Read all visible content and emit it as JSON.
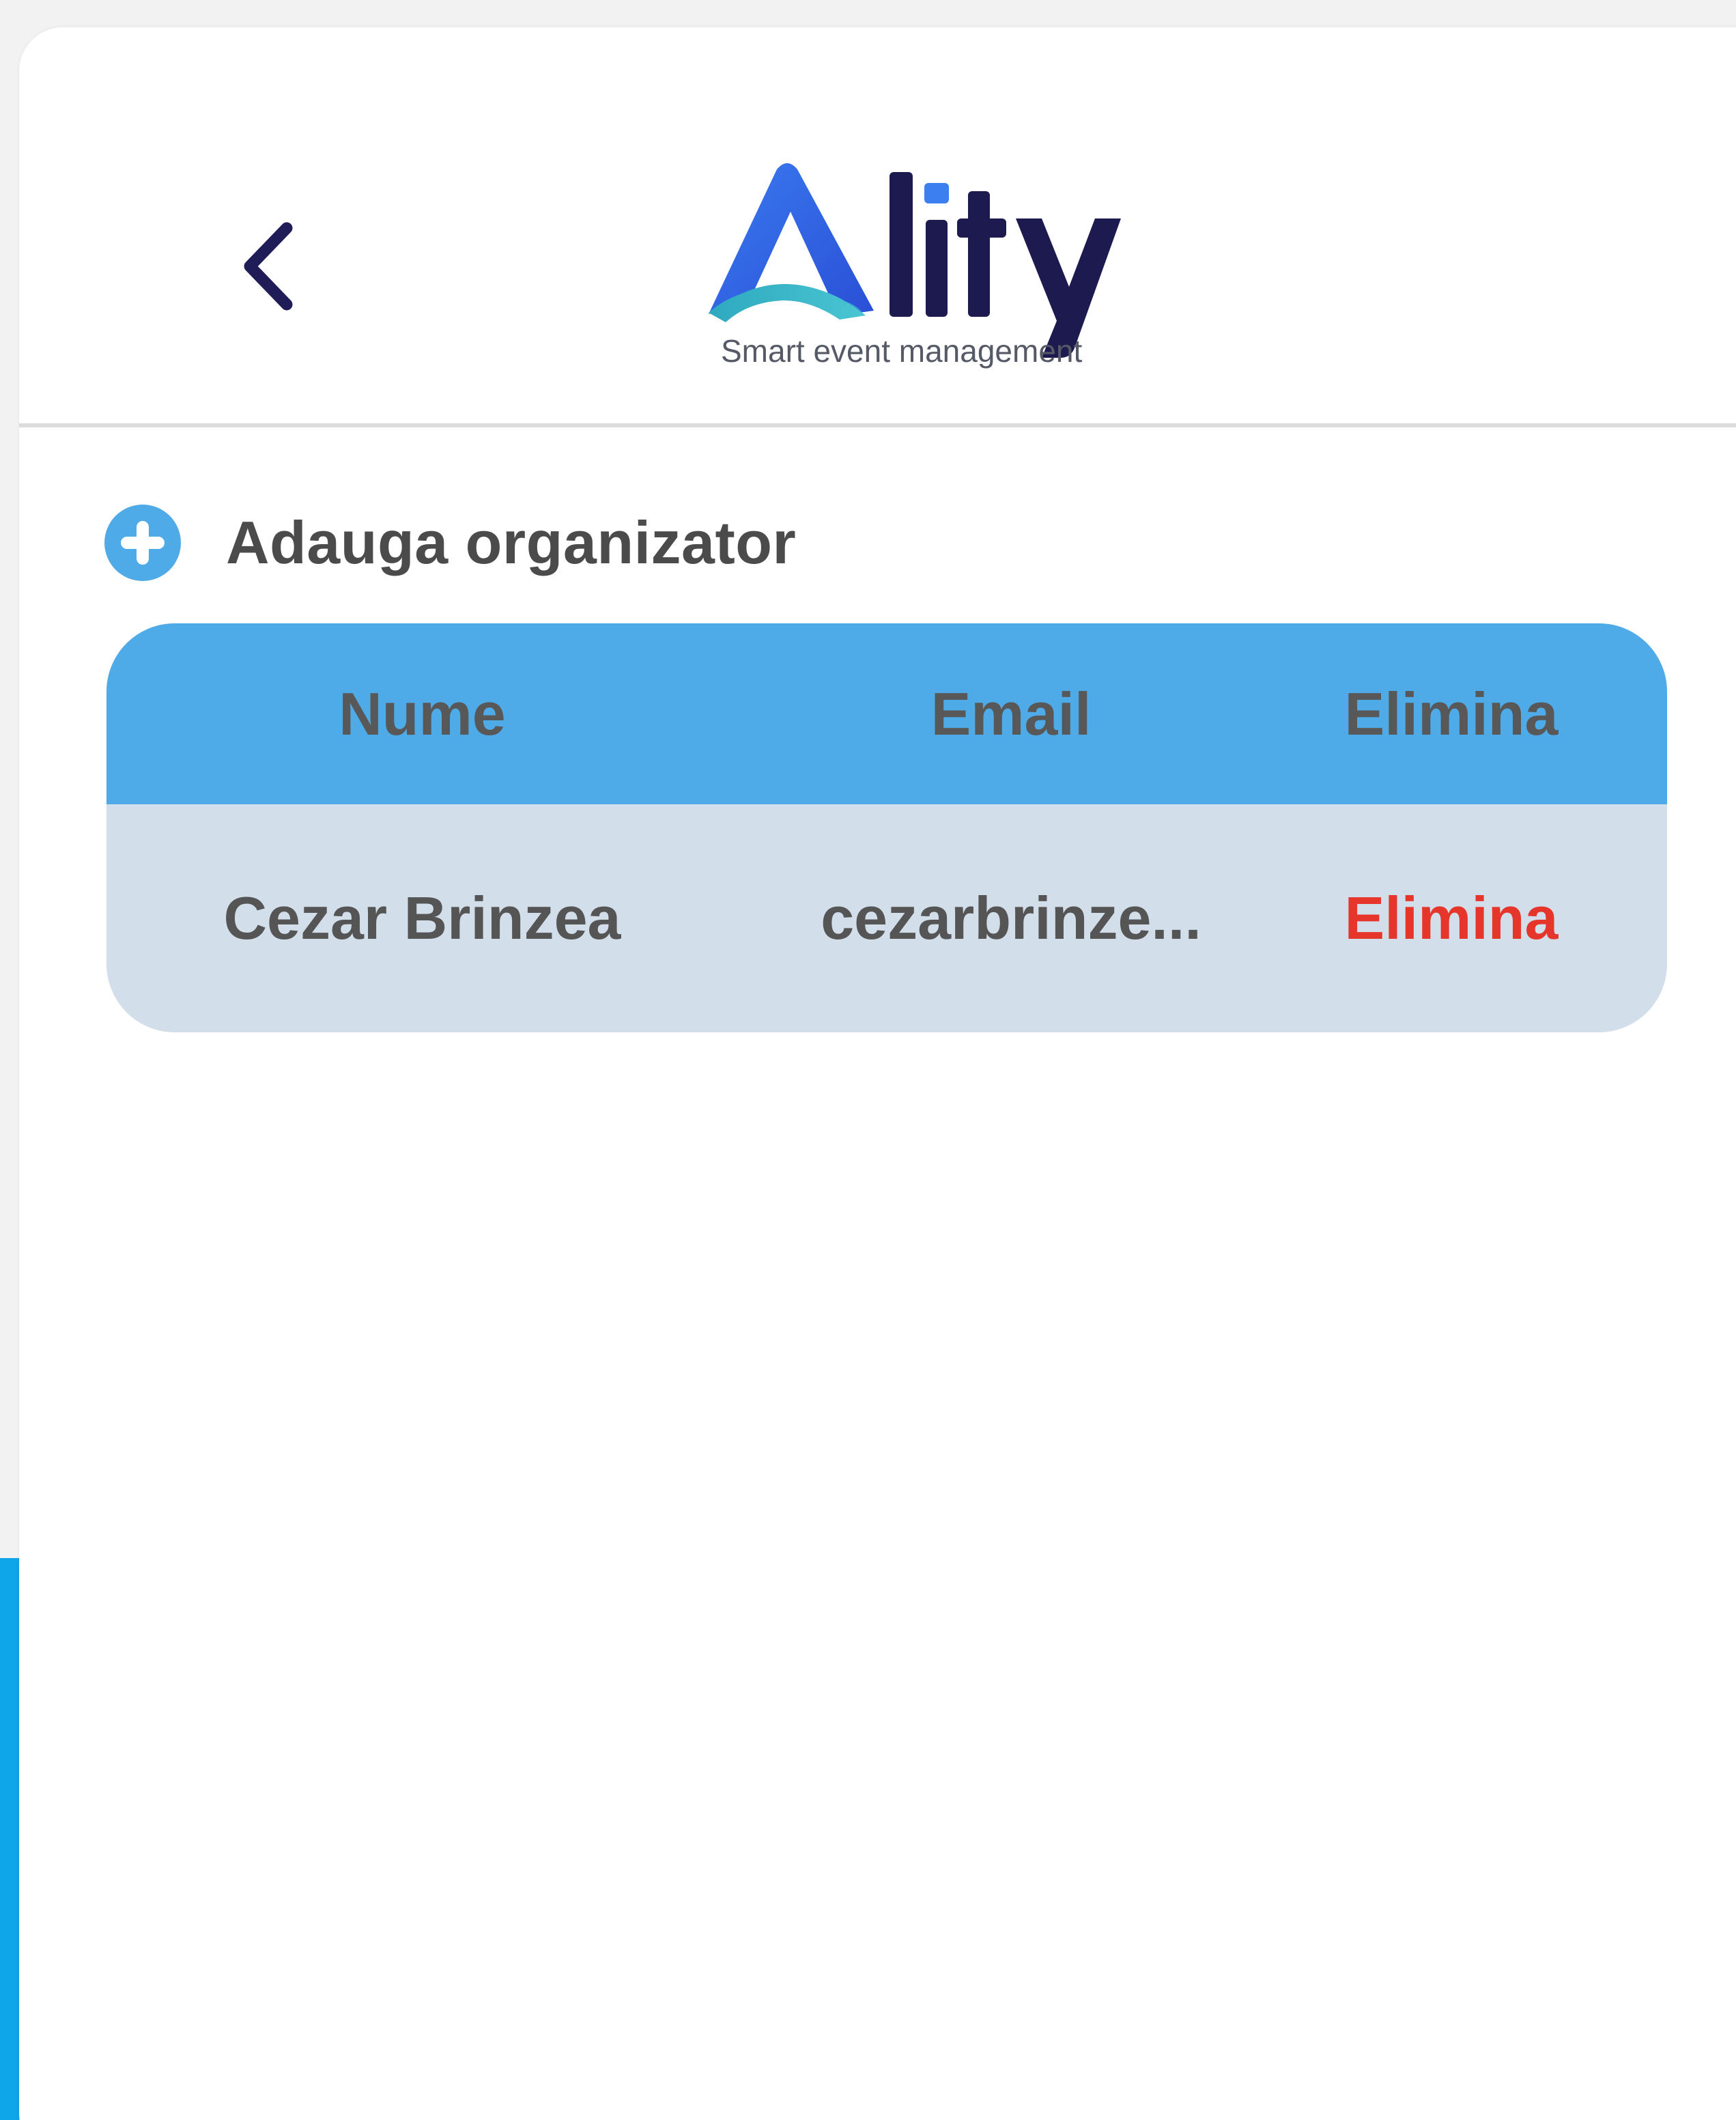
{
  "header": {
    "logo": {
      "wordmark": "Ality",
      "tagline": "Smart event management",
      "colors": {
        "primary": "#2d62e6",
        "accent": "#31b7c6",
        "dark": "#1c1a4f",
        "dot": "#3b7ff0"
      }
    },
    "back_icon": "chevron-left-icon"
  },
  "actions": {
    "add_organizer": {
      "label": "Adauga organizator",
      "icon": "plus-circle-icon",
      "color": "#4faae8"
    }
  },
  "table": {
    "columns": [
      "Nume",
      "Email",
      "Elimina"
    ],
    "rows": [
      {
        "name": "Cezar Brinzea",
        "email": "cezarbrinze...",
        "remove_label": "Elimina"
      }
    ],
    "colors": {
      "header": "#4faae8",
      "body": "#d2deea",
      "remove": "#e6352b"
    }
  }
}
